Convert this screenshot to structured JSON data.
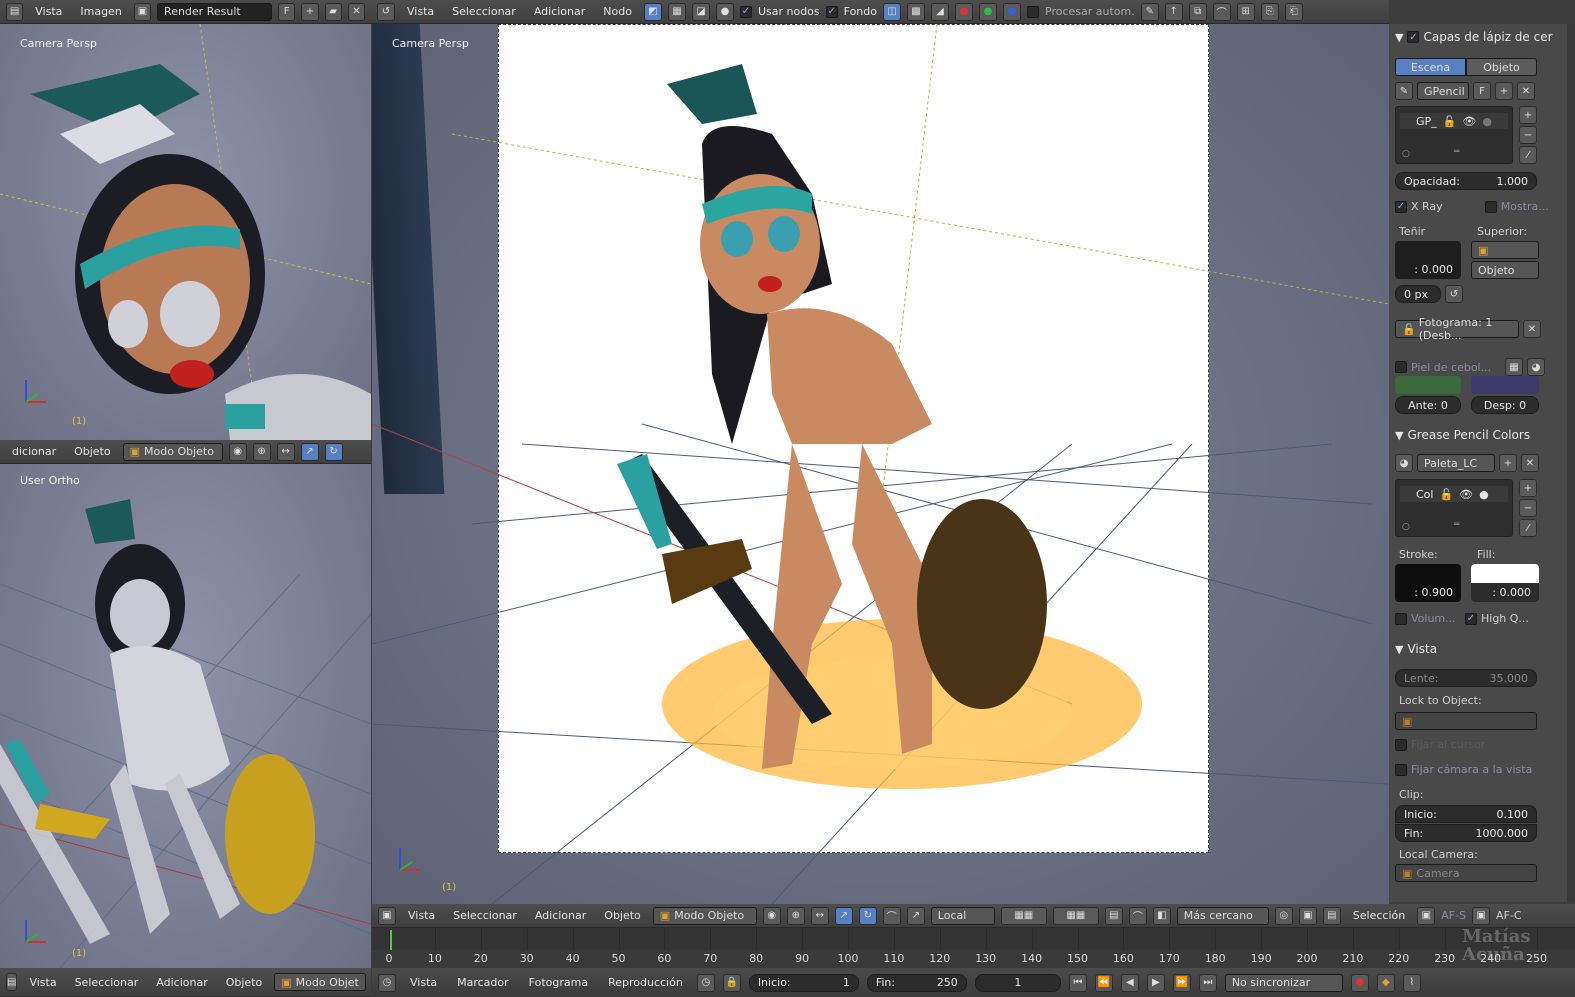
{
  "top_left_header": {
    "menus": [
      "Vista",
      "Imagen"
    ],
    "image_name": "Render Result",
    "f_label": "F"
  },
  "node_header": {
    "menus": [
      "Vista",
      "Seleccionar",
      "Adicionar",
      "Nodo"
    ],
    "use_nodes": "Usar nodos",
    "backdrop": "Fondo",
    "auto_process": "Procesar autom."
  },
  "viewport_tl": {
    "label": "Camera Persp",
    "frame": "(1)",
    "header_items": [
      "dicionar",
      "Objeto"
    ],
    "mode": "Modo Objeto"
  },
  "viewport_bl": {
    "label": "User Ortho",
    "frame": "(1)",
    "header_items": [
      "Vista",
      "Seleccionar",
      "Adicionar",
      "Objeto"
    ],
    "mode": "Modo Objeto"
  },
  "viewport_main": {
    "label": "Camera Persp",
    "frame": "(1)"
  },
  "main_header": {
    "menus": [
      "Vista",
      "Seleccionar",
      "Adicionar",
      "Objeto"
    ],
    "mode": "Modo Objeto",
    "orientation": "Local",
    "snap": "Más cercano",
    "selection": "Selección",
    "afs": "AF-S",
    "afc": "AF-C"
  },
  "props": {
    "gp_layers_title": "Capas de lápiz de cer",
    "tab_scene": "Escena",
    "tab_object": "Objeto",
    "gpencil_name": "GPencil",
    "f_label": "F",
    "layer_name": "GP_",
    "opacity_label": "Opacidad:",
    "opacity_value": "1.000",
    "xray": "X Ray",
    "show": "Mostra...",
    "tint_label": "Teñir",
    "parent_label": "Superior:",
    "tint_value": ": 0.000",
    "parent_value": "Objeto",
    "thickness": "0 px",
    "frame_label": "Fotograma: 1 (Desb...",
    "onion": "Piel de cebol...",
    "before": "Ante: 0",
    "after": "Desp: 0",
    "colors_title": "Grease Pencil Colors",
    "palette": "Paleta_LC",
    "color_name": "Col",
    "stroke_label": "Stroke:",
    "fill_label": "Fill:",
    "stroke_value": ": 0.900",
    "fill_value": ": 0.000",
    "volume": "Volum...",
    "hq": "High Q...",
    "view_title": "Vista",
    "lens_label": "Lente:",
    "lens_value": "35.000",
    "lock_label": "Lock to Object:",
    "lock_cursor": "Fijar al cursor",
    "lock_camera": "Fijar cámara a la vista",
    "clip_label": "Clip:",
    "clip_start_label": "Inicio:",
    "clip_start": "0.100",
    "clip_end_label": "Fin:",
    "clip_end": "1000.000",
    "local_camera_label": "Local Camera:",
    "camera": "Camera"
  },
  "timeline": {
    "ticks": [
      "0",
      "10",
      "20",
      "30",
      "40",
      "50",
      "60",
      "70",
      "80",
      "90",
      "100",
      "110",
      "120",
      "130",
      "140",
      "150",
      "160",
      "170",
      "180",
      "190",
      "200",
      "210",
      "220",
      "230",
      "240",
      "250"
    ]
  },
  "bottom_left_header": {
    "menus": [
      "Vista",
      "Seleccionar",
      "Adicionar",
      "Objeto"
    ],
    "mode": "Modo Objet"
  },
  "bottom_header": {
    "menus": [
      "Vista",
      "Marcador",
      "Fotograma",
      "Reproducción"
    ],
    "start_label": "Inicio:",
    "start": "1",
    "end_label": "Fin:",
    "end": "250",
    "current": "1",
    "sync": "No sincronizar"
  },
  "watermark": {
    "line1": "Matías",
    "line2": "Acuña"
  }
}
